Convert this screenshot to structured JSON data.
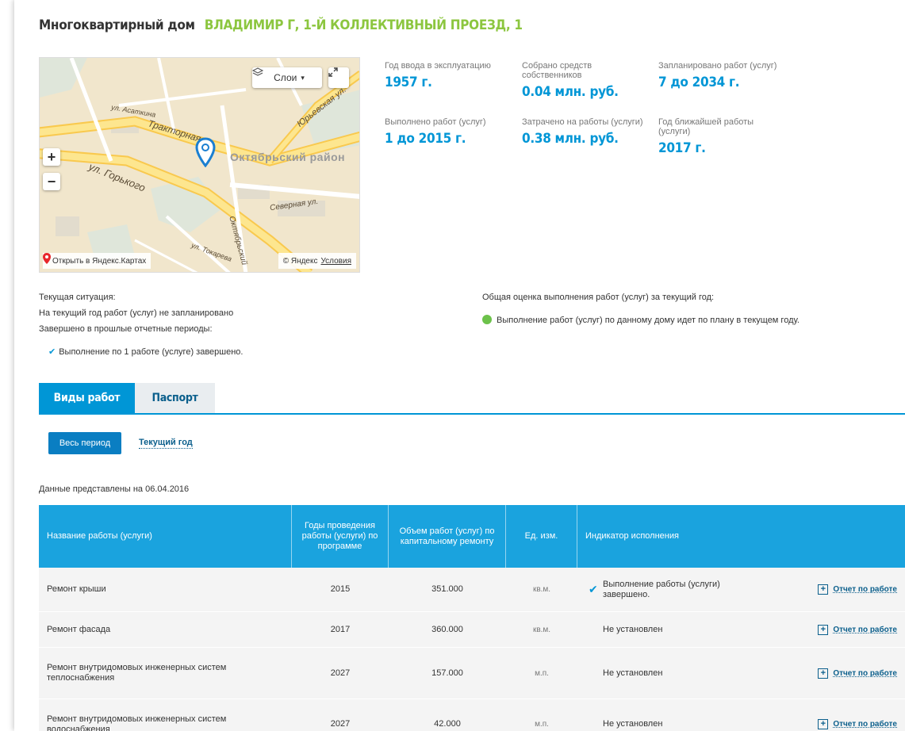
{
  "header": {
    "type_label": "Многоквартирный дом",
    "address": "ВЛАДИМИР Г, 1-Й КОЛЛЕКТИВНЫЙ ПРОЕЗД, 1"
  },
  "map": {
    "layers_label": "Слои",
    "open_yandex": "Открыть в Яндекс.Картах",
    "copyright": "© Яндекс",
    "terms_link": "Условия",
    "district": "Октябрьский район",
    "streets": {
      "traktornaya": "Тракторная ул.",
      "gorkogo": "ул. Горького",
      "severnaya": "Северная ул.",
      "yurevskaya": "Юрьевская ул.",
      "asatkina": "ул. Асаткина",
      "tokareva": "ул. Токарева",
      "oktyabrsky": "Октябрьский"
    }
  },
  "stats": [
    {
      "label": "Год ввода в эксплуатацию",
      "value": "1957 г."
    },
    {
      "label": "Собрано средств собственников",
      "value": "0.04 млн. руб."
    },
    {
      "label": "Запланировано работ (услуг)",
      "value": "7 до 2034 г."
    },
    {
      "label": "Выполнено работ (услуг)",
      "value": "1 до 2015 г."
    },
    {
      "label": "Затрачено на работы (услуги)",
      "value": "0.38 млн. руб."
    },
    {
      "label": "Год ближайшей работы (услуги)",
      "value": "2017 г."
    }
  ],
  "situation": {
    "title": "Текущая ситуация:",
    "current": "На текущий год работ (услуг) не запланировано",
    "past_title": "Завершено в прошлые отчетные периоды:",
    "past_item": "Выполнение по 1 работе (услуге) завершено.",
    "overall_title": "Общая оценка выполнения работ (услуг) за текущий год:",
    "overall_status": "Выполнение работ (услуг) по данному дому идет по плану в текущем году."
  },
  "tabs": [
    "Виды работ",
    "Паспорт"
  ],
  "period": {
    "all": "Весь период",
    "current": "Текущий год"
  },
  "as_of": "Данные представлены на 06.04.2016",
  "table": {
    "headers": [
      "Название работы (услуги)",
      "Годы проведения работы (услуги) по программе",
      "Объем работ (услуг) по капитальному ремонту",
      "Ед. изм.",
      "Индикатор исполнения"
    ],
    "report_label": "Отчет по работе",
    "rows": [
      {
        "name": "Ремонт крыши",
        "year": "2015",
        "volume": "351.000",
        "unit": "кв.м.",
        "indicator": "Выполнение работы (услуги) завершено."
      },
      {
        "name": "Ремонт фасада",
        "year": "2017",
        "volume": "360.000",
        "unit": "кв.м.",
        "indicator": "Не установлен"
      },
      {
        "name": "Ремонт внутридомовых инженерных систем теплоснабжения",
        "year": "2027",
        "volume": "157.000",
        "unit": "м.п.",
        "indicator": "Не установлен"
      },
      {
        "name": "Ремонт внутридомовых инженерных систем водоснабжения",
        "year": "2027",
        "volume": "42.000",
        "unit": "м.п.",
        "indicator": "Не установлен"
      }
    ]
  },
  "colors": {
    "accent_blue": "#0096d6",
    "header_blue": "#1aa3de",
    "address_green": "#8cc63f",
    "status_green": "#6cc24a"
  }
}
